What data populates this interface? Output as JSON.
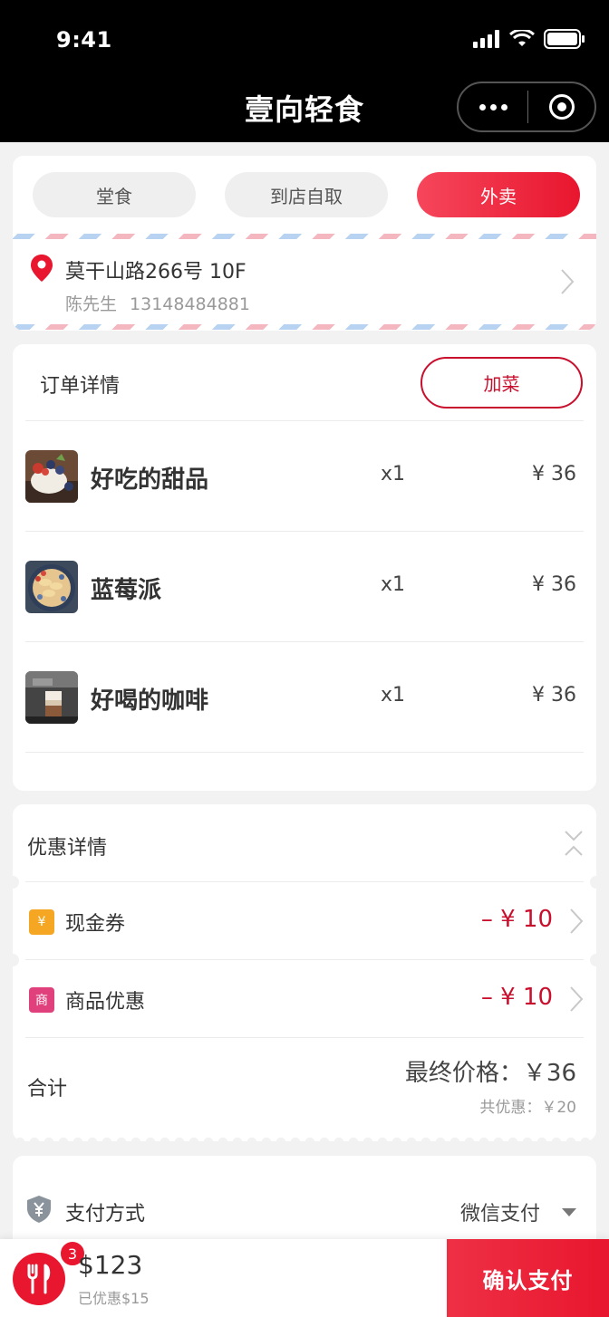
{
  "status_bar": {
    "time": "9:41"
  },
  "nav": {
    "title": "壹向轻食"
  },
  "order_modes": [
    {
      "label": "堂食",
      "active": false
    },
    {
      "label": "到店自取",
      "active": false
    },
    {
      "label": "外卖",
      "active": true
    }
  ],
  "address": {
    "line": "莫干山路266号 10F",
    "contact_name": "陈先生",
    "phone": "13148484881"
  },
  "order": {
    "title": "订单详情",
    "add_button": "加菜",
    "items": [
      {
        "name": "好吃的甜品",
        "qty": "x1",
        "price": "¥ 36",
        "thumb": "dessert-image"
      },
      {
        "name": "蓝莓派",
        "qty": "x1",
        "price": "¥ 36",
        "thumb": "blueberry-pie-image"
      },
      {
        "name": "好喝的咖啡",
        "qty": "x1",
        "price": "¥ 36",
        "thumb": "coffee-image"
      }
    ]
  },
  "discounts": {
    "title": "优惠详情",
    "rows": [
      {
        "icon_text": "¥",
        "icon_color": "#f5a623",
        "label": "现金券",
        "value": "– ¥ 10"
      },
      {
        "icon_text": "商",
        "icon_color": "#e0407b",
        "label": "商品优惠",
        "value": "– ¥ 10"
      }
    ],
    "total_label": "合计",
    "final_price": "最终价格：￥36",
    "saved": "共优惠：￥20"
  },
  "payment": {
    "label": "支付方式",
    "method": "微信支付"
  },
  "bottom": {
    "cart_count": "3",
    "total": "$123",
    "saved": "已优惠$15",
    "confirm_button": "确认支付"
  },
  "colors": {
    "accent": "#e8162e",
    "price_red": "#c8102e",
    "background": "#f2f2f2"
  }
}
